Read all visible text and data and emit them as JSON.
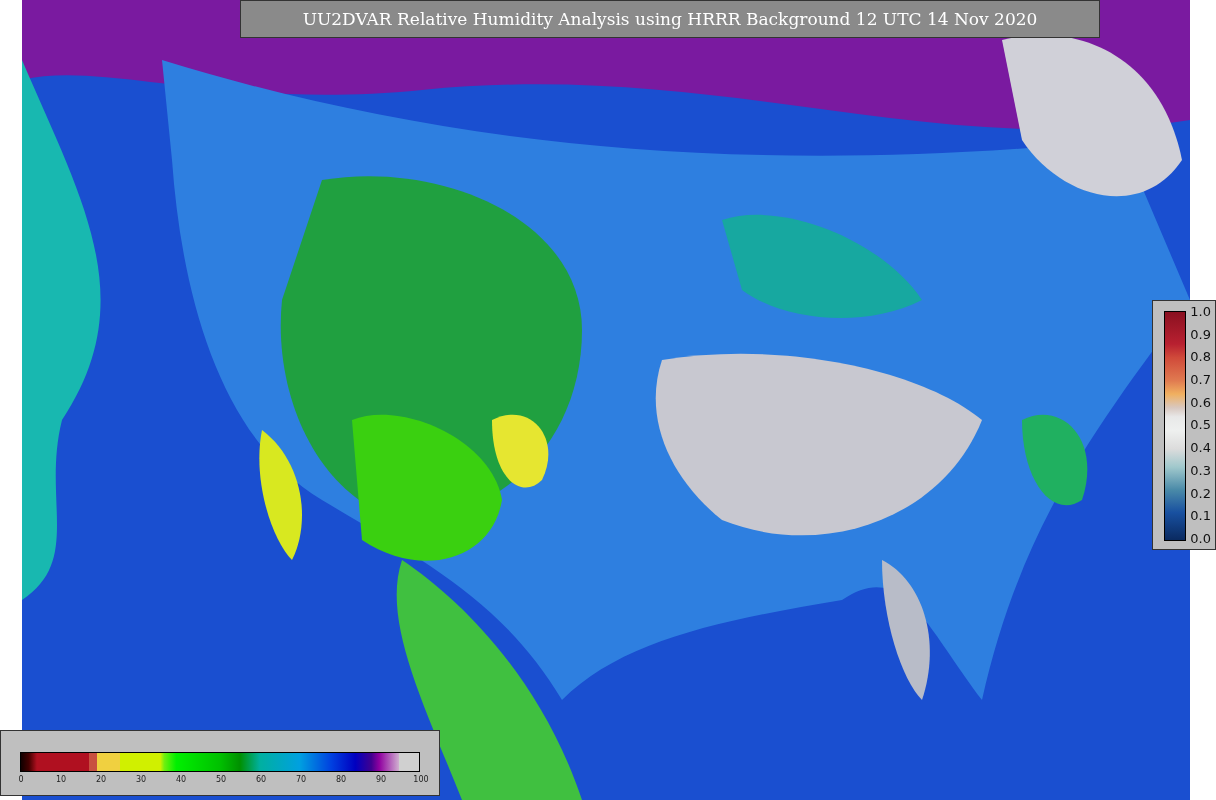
{
  "title": "UU2DVAR Relative Humidity Analysis using HRRR Background 12 UTC 14 Nov 2020",
  "humidity_colorbar": {
    "ticks": [
      "0",
      "10",
      "20",
      "30",
      "40",
      "50",
      "60",
      "70",
      "80",
      "90",
      "100"
    ]
  },
  "observation_colorbar": {
    "ticks": [
      "1.0",
      "0.9",
      "0.8",
      "0.7",
      "0.6",
      "0.5",
      "0.4",
      "0.3",
      "0.2",
      "0.1",
      "0.0"
    ]
  }
}
